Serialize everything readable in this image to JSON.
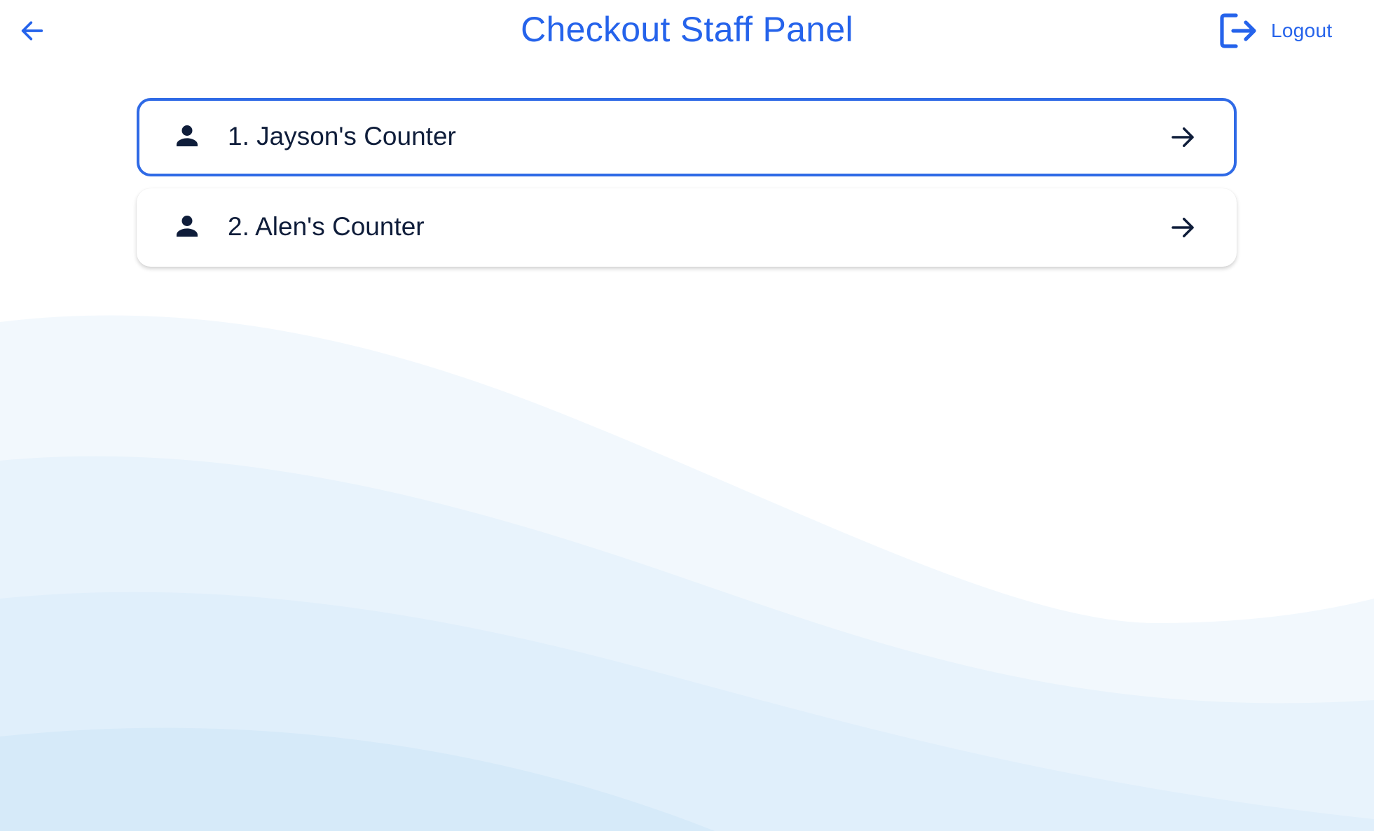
{
  "header": {
    "title": "Checkout Staff Panel",
    "back_icon": "arrow-left-icon",
    "logout_icon": "logout-icon",
    "logout_label": "Logout"
  },
  "counters": [
    {
      "label": "1. Jayson's Counter",
      "icon": "person-icon",
      "action_icon": "arrow-right-icon",
      "selected": true
    },
    {
      "label": "2. Alen's Counter",
      "icon": "person-icon",
      "action_icon": "arrow-right-icon",
      "selected": false
    }
  ],
  "colors": {
    "accent": "#2563eb",
    "text_dark": "#0f1d3a",
    "wave_light": "#f2f8fd",
    "wave_mid": "#e6f2fc",
    "wave_deep": "#d6eaf9"
  }
}
